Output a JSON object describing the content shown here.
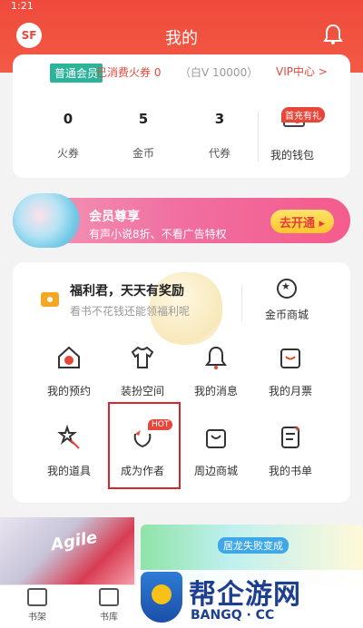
{
  "status_time": "1:21",
  "header": {
    "title": "我的",
    "logo_text": "SF"
  },
  "account": {
    "member_badge": "普通会员",
    "spent": "已消费火券 0",
    "white_threshold": "（白V 10000）",
    "vip_center": "VIP中心 >",
    "stats": [
      {
        "value": "0",
        "label": "火券"
      },
      {
        "value": "5",
        "label": "金币"
      },
      {
        "value": "3",
        "label": "代券"
      }
    ],
    "wallet_tag": "首充有礼",
    "wallet_label": "我的钱包"
  },
  "vip_banner": {
    "title": "会员尊享",
    "subtitle": "有声小说8折、不看广告特权",
    "button": "去开通 ▸"
  },
  "welfare": {
    "title": "福利君，天天有奖励",
    "subtitle": "看书不花钱还能领福利呢",
    "coin_shop": "金币商城"
  },
  "grid": [
    {
      "label": "我的预约",
      "icon": "home-clock-icon"
    },
    {
      "label": "装扮空间",
      "icon": "tshirt-icon"
    },
    {
      "label": "我的消息",
      "icon": "bell-icon"
    },
    {
      "label": "我的月票",
      "icon": "ticket-icon"
    },
    {
      "label": "我的道具",
      "icon": "wand-icon"
    },
    {
      "label": "成为作者",
      "icon": "bird-icon"
    },
    {
      "label": "周边商城",
      "icon": "bag-icon"
    },
    {
      "label": "我的书单",
      "icon": "list-icon"
    }
  ],
  "hot_tag": "HOT",
  "promo": {
    "left_text": "Agile",
    "right_text": "居龙失败变成"
  },
  "tabs": [
    {
      "label": "书架"
    },
    {
      "label": "书库"
    }
  ],
  "watermark": {
    "cn": "帮企游网",
    "en": "BANGQ · CC"
  }
}
